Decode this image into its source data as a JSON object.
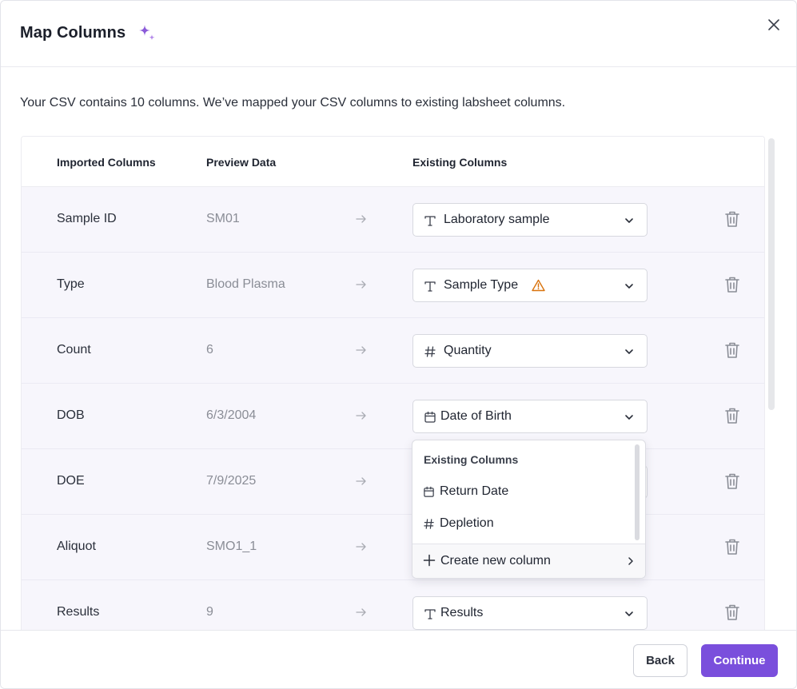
{
  "dialog": {
    "title": "Map Columns",
    "subtitle": "Your CSV contains 10 columns. We’ve mapped your CSV columns to existing labsheet columns."
  },
  "table": {
    "headers": {
      "imported": "Imported Columns",
      "preview": "Preview Data",
      "existing": "Existing Columns"
    },
    "rows": [
      {
        "name": "Sample ID",
        "preview": "SM01",
        "existing": "Laboratory sample",
        "type_icon": "text-type-icon",
        "warning": false
      },
      {
        "name": "Type",
        "preview": "Blood Plasma",
        "existing": "Sample Type",
        "type_icon": "text-type-icon",
        "warning": true
      },
      {
        "name": "Count",
        "preview": "6",
        "existing": "Quantity",
        "type_icon": "hash-icon",
        "warning": false
      },
      {
        "name": "DOB",
        "preview": "6/3/2004",
        "existing": "Date of Birth",
        "type_icon": "calendar-icon",
        "warning": false
      },
      {
        "name": "DOE",
        "preview": "7/9/2025",
        "existing": "",
        "type_icon": "",
        "warning": false
      },
      {
        "name": "Aliquot",
        "preview": "SMO1_1",
        "existing": "",
        "type_icon": "",
        "warning": false
      },
      {
        "name": "Results",
        "preview": "9",
        "existing": "Results",
        "type_icon": "text-type-icon",
        "warning": false
      }
    ]
  },
  "dropdown": {
    "heading": "Existing Columns",
    "items": [
      {
        "label": "Return Date",
        "icon": "calendar-icon"
      },
      {
        "label": "Depletion",
        "icon": "hash-icon"
      }
    ],
    "create_label": "Create new column"
  },
  "footer": {
    "back_label": "Back",
    "continue_label": "Continue"
  },
  "colors": {
    "accent": "#7a4fdc",
    "row_bg": "#f7f6fc",
    "warning": "#d9730d"
  }
}
